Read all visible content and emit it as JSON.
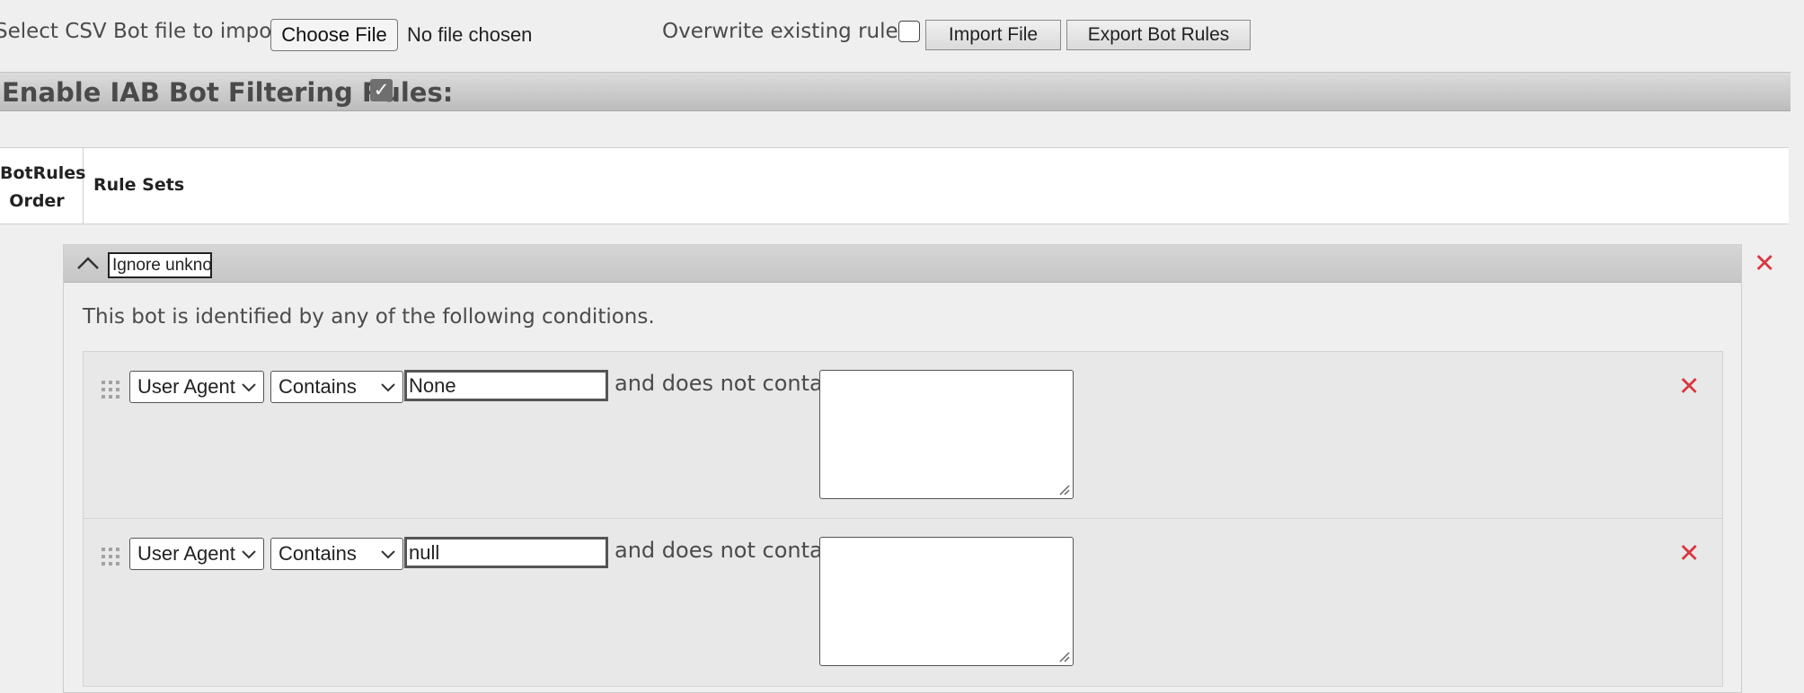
{
  "import_bar": {
    "label": "Select CSV Bot file to import:",
    "choose_file_label": "Choose File",
    "file_status": "No file chosen",
    "overwrite_label": "Overwrite existing rules:",
    "overwrite_checked": false,
    "import_button": "Import File",
    "export_button": "Export Bot Rules"
  },
  "iab": {
    "title": "Enable IAB Bot Filtering Rules:",
    "checked": true,
    "check_glyph": "✓"
  },
  "table_header": {
    "order_line1": "BotRules",
    "order_line2": "Order",
    "rule_sets": "Rule Sets"
  },
  "rule_set": {
    "name_value": "Ignore unkno",
    "remove_glyph": "✕",
    "conditions_text": "This bot is identified by any of the following conditions.",
    "rules": [
      {
        "field": "User Agent",
        "operator": "Contains",
        "value": "None",
        "and_not_label": "and does not contain",
        "exclusions": "",
        "remove_glyph": "✕"
      },
      {
        "field": "User Agent",
        "operator": "Contains",
        "value": "null",
        "and_not_label": "and does not contain",
        "exclusions": "",
        "remove_glyph": "✕"
      }
    ]
  },
  "icons": {
    "collapse": "chevron-up-icon",
    "drag": "drag-handle-icon",
    "remove": "close-icon",
    "dropdown": "chevron-down-icon"
  },
  "colors": {
    "remove_red": "#d7373f",
    "checkbox_fill": "#6f6f6f",
    "bar_gradient_top": "#dcdcdc",
    "bar_gradient_bottom": "#bcbcbc"
  }
}
